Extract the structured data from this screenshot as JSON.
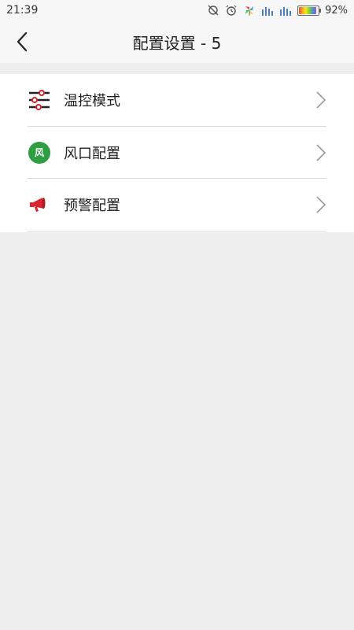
{
  "status_bar": {
    "time": "21:39",
    "battery_text": "92%",
    "battery_level": 0.92,
    "icons": [
      "sync-off-icon",
      "alarm-icon",
      "pinwheel-icon",
      "signal-icon",
      "signal-icon",
      "battery-icon"
    ]
  },
  "header": {
    "title": "配置设置 - 5",
    "back_icon": "chevron-left-icon"
  },
  "menu": {
    "items": [
      {
        "label": "温控模式",
        "icon": "sliders-icon"
      },
      {
        "label": "风口配置",
        "icon": "wind-badge-icon",
        "badge_text": "风",
        "badge_color": "#2e9e43"
      },
      {
        "label": "预警配置",
        "icon": "megaphone-icon",
        "icon_color": "#d9232e"
      }
    ]
  },
  "colors": {
    "page_bg": "#ededed",
    "bar_bg": "#f6f6f6",
    "divider": "#dcdcdc",
    "text": "#222222"
  }
}
